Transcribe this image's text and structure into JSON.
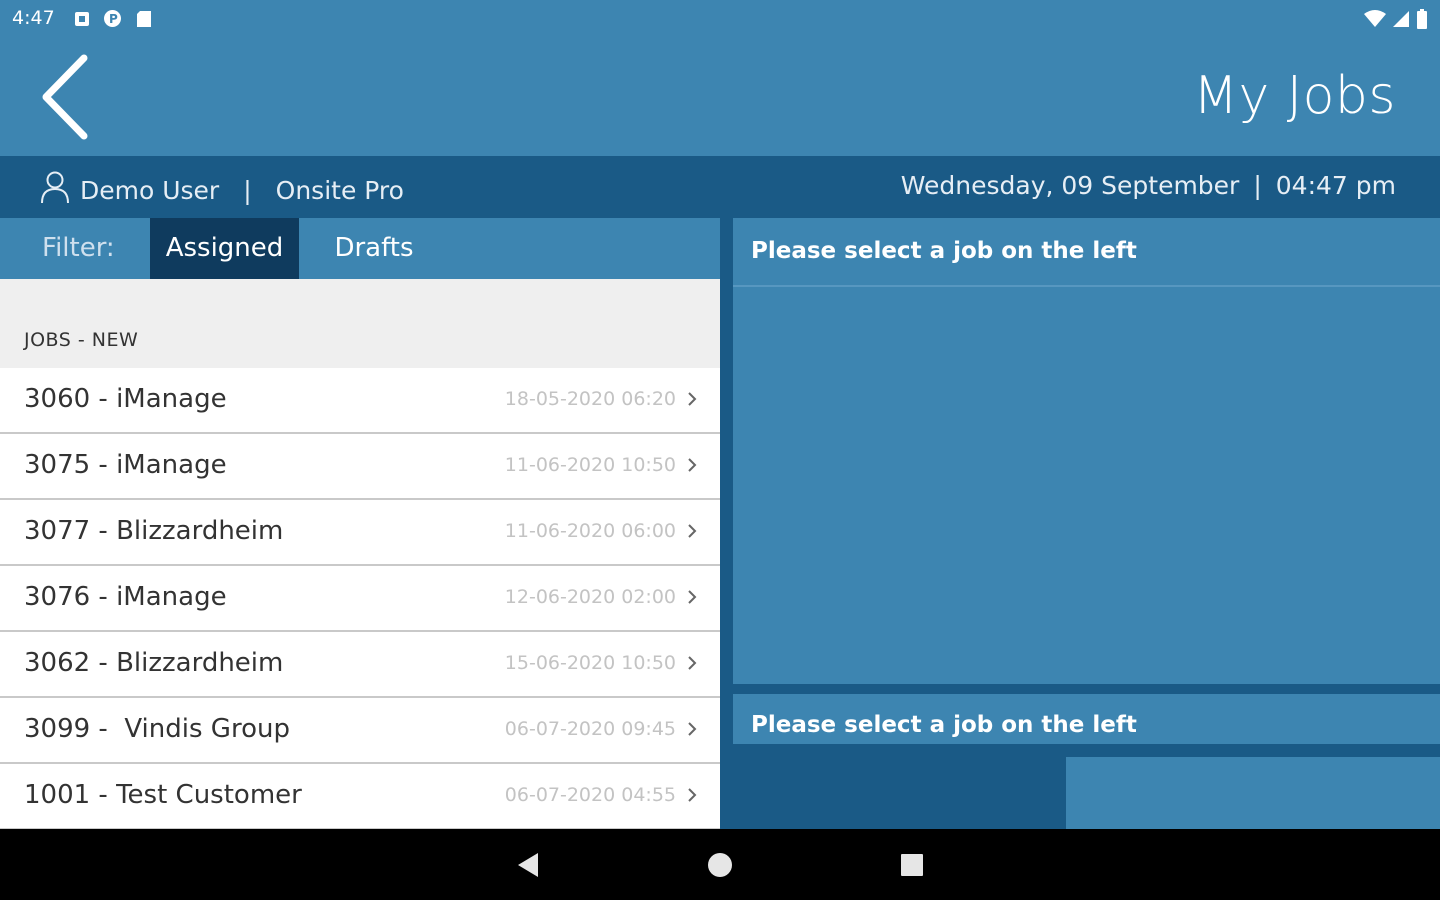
{
  "status_bar": {
    "time": "4:47",
    "icons": [
      "notification-square-icon",
      "data-saver-icon",
      "sd-card-icon"
    ],
    "right_icons": [
      "wifi-icon",
      "cell-signal-icon",
      "battery-icon"
    ]
  },
  "header": {
    "title": "My Jobs",
    "back_icon": "chevron-left-icon"
  },
  "user_bar": {
    "user_name": "Demo User",
    "separator": "|",
    "product": "Onsite Pro",
    "date": "Wednesday, 09 September",
    "time": "04:47 pm"
  },
  "filter": {
    "label": "Filter:",
    "tabs": [
      {
        "label": "Assigned",
        "active": true
      },
      {
        "label": "Drafts",
        "active": false
      }
    ]
  },
  "jobs_section": {
    "header": "JOBS - NEW",
    "items": [
      {
        "title": "3060 - iManage",
        "date": "18-05-2020 06:20"
      },
      {
        "title": "3075 - iManage",
        "date": "11-06-2020 10:50"
      },
      {
        "title": "3077 - Blizzardheim",
        "date": "11-06-2020 06:00"
      },
      {
        "title": "3076 - iManage",
        "date": "12-06-2020 02:00"
      },
      {
        "title": "3062 - Blizzardheim",
        "date": "15-06-2020 10:50"
      },
      {
        "title": "3099 -  Vindis Group",
        "date": "06-07-2020 09:45"
      },
      {
        "title": "1001 - Test Customer",
        "date": "06-07-2020 04:55"
      }
    ]
  },
  "detail": {
    "top_message": "Please select a job on the left",
    "bottom_message": "Please select a job on the left"
  },
  "nav_bar": {
    "icons": [
      "back-triangle-icon",
      "home-circle-icon",
      "recents-square-icon"
    ]
  },
  "colors": {
    "primary": "#3d85b1",
    "dark": "#1a5a86",
    "active_tab": "#0f3b5e"
  }
}
